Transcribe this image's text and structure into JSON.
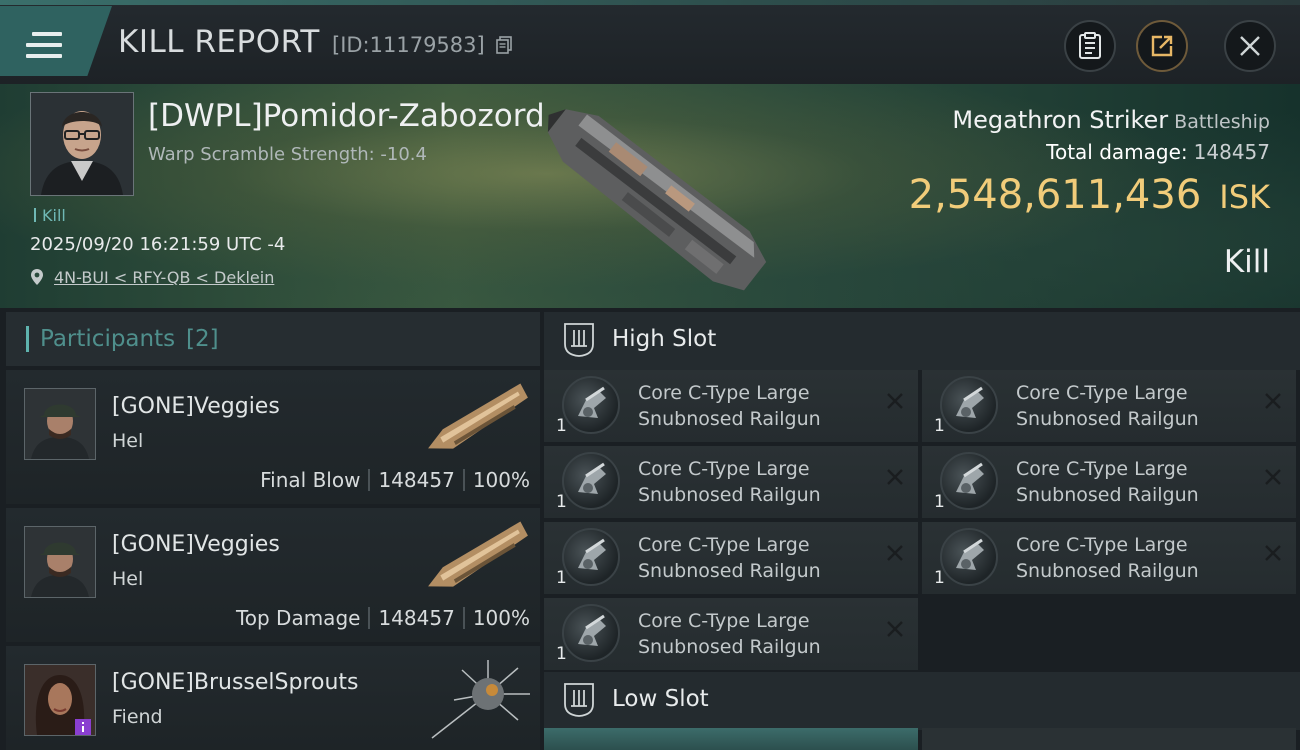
{
  "header": {
    "title": "KILL REPORT",
    "report_id": "[ID:11179583]"
  },
  "victim": {
    "name": "[DWPL]Pomidor-Zabozord",
    "warp_scramble": "Warp Scramble Strength: -10.4",
    "kill_tag": "Kill",
    "timestamp": "2025/09/20 16:21:59 UTC -4",
    "location": "4N-BUI < RFY-QB < Deklein",
    "ship_name": "Megathron Striker",
    "ship_class": "Battleship",
    "total_damage_label": "Total damage:",
    "total_damage_value": "148457",
    "isk_value": "2,548,611,436",
    "isk_unit": "ISK",
    "result": "Kill"
  },
  "participants": {
    "title": "Participants",
    "count": "[2]",
    "rows": [
      {
        "name": "[GONE]Veggies",
        "ship": "Hel",
        "role": "Final Blow",
        "damage": "148457",
        "percent": "100%"
      },
      {
        "name": "[GONE]Veggies",
        "ship": "Hel",
        "role": "Top Damage",
        "damage": "148457",
        "percent": "100%"
      },
      {
        "name": "[GONE]BrusselSprouts",
        "ship": "Fiend"
      }
    ]
  },
  "slots": {
    "high": {
      "title": "High Slot",
      "modules": [
        {
          "line1": "Core C-Type Large",
          "line2": "Snubnosed Railgun",
          "qty": "1"
        },
        {
          "line1": "Core C-Type Large",
          "line2": "Snubnosed Railgun",
          "qty": "1"
        },
        {
          "line1": "Core C-Type Large",
          "line2": "Snubnosed Railgun",
          "qty": "1"
        },
        {
          "line1": "Core C-Type Large",
          "line2": "Snubnosed Railgun",
          "qty": "1"
        },
        {
          "line1": "Core C-Type Large",
          "line2": "Snubnosed Railgun",
          "qty": "1"
        },
        {
          "line1": "Core C-Type Large",
          "line2": "Snubnosed Railgun",
          "qty": "1"
        },
        {
          "line1": "Core C-Type Large",
          "line2": "Snubnosed Railgun",
          "qty": "1"
        }
      ]
    },
    "low": {
      "title": "Low Slot"
    }
  },
  "icons": {
    "menu": "menu-icon",
    "copy": "copy-icon",
    "clipboard": "clipboard-icon",
    "share": "share-icon",
    "close": "close-icon",
    "location": "location-pin-icon",
    "slot": "slot-icon",
    "module_close": "close-icon"
  },
  "colors": {
    "accent_teal": "#2f6260",
    "isk_gold": "#f1cc7a",
    "participants_title": "#4f8f8c"
  }
}
